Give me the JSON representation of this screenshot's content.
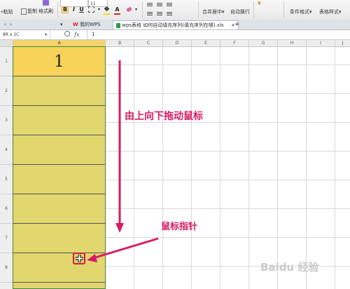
{
  "ribbon": {
    "paste_label": "粘贴",
    "copy_label": "复制",
    "format_painter_label": "格式刷",
    "font_size_value": "11",
    "bold_label": "B",
    "italic_label": "I",
    "underline_label": "U",
    "merge_center_label": "合并居中",
    "auto_wrap_label": "自动换行",
    "conditional_format_label": "条件格式",
    "table_style_label": "表格样式"
  },
  "tabs": {
    "my_wps": "我的WPS",
    "file_tab": "wps表格 如何自动填充序列(填充序列在哪).xls",
    "close_symbol": "×",
    "add_symbol": "+"
  },
  "formula_bar": {
    "name_box": "8R x 1C",
    "fx_label": "fx",
    "value": "1"
  },
  "columns": [
    "A",
    "B",
    "C",
    "D",
    "E",
    "F",
    "G",
    "H",
    "I",
    "J"
  ],
  "rows": [
    "1",
    "2",
    "3",
    "4",
    "5",
    "6",
    "7",
    "8"
  ],
  "cells": {
    "A1": "1"
  },
  "annotations": {
    "drag_instruction": "由上向下拖动鼠标",
    "pointer_label": "鼠标指针"
  },
  "watermark": "Baidu 经验",
  "colors": {
    "selection_fill": "#e2d66e",
    "active_cell_fill": "#f7d35a",
    "annotation": "#d61c64",
    "wps_red": "#d9261c"
  }
}
